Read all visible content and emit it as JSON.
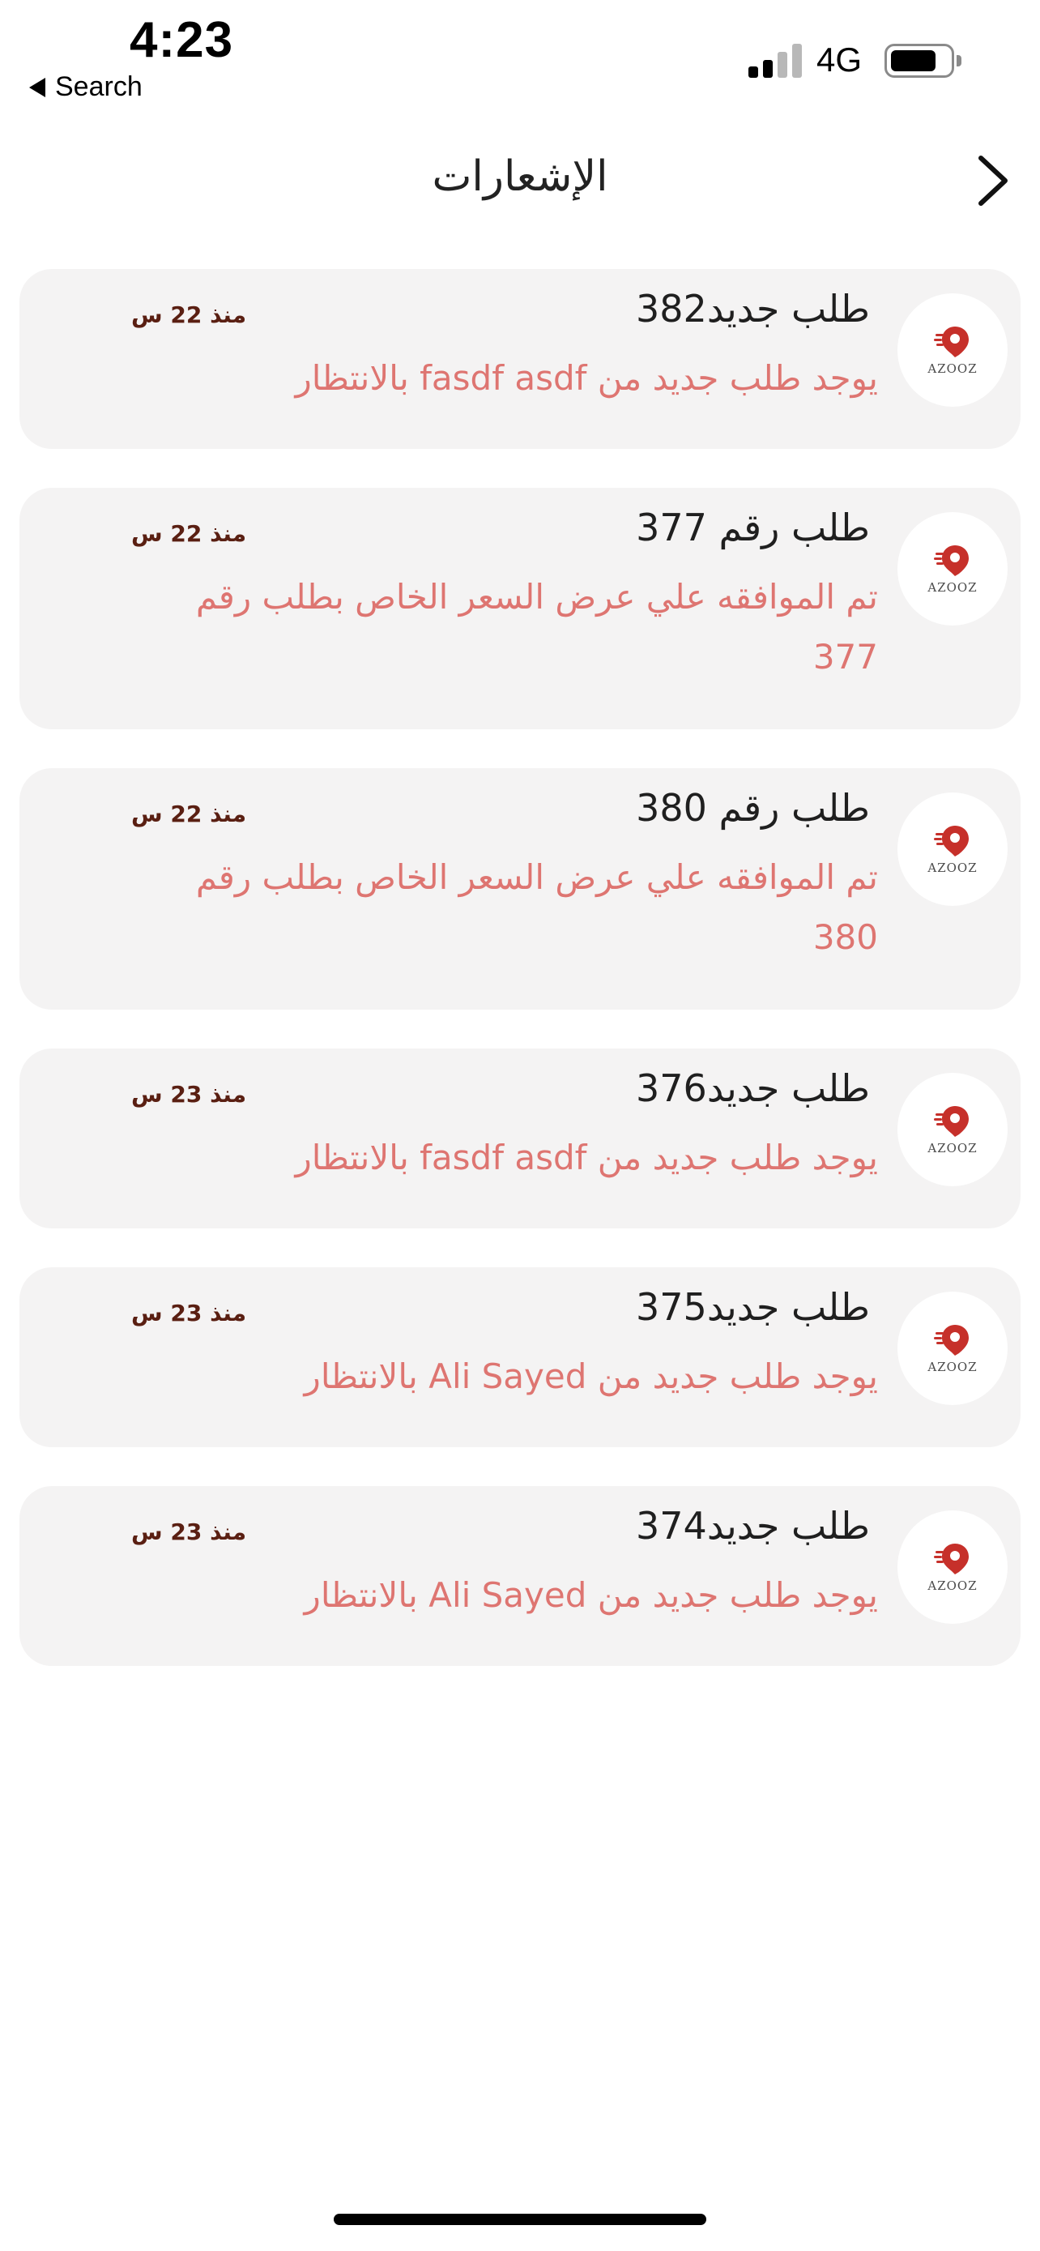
{
  "status_bar": {
    "time": "4:23",
    "back_app_label": "Search",
    "network": "4G"
  },
  "header": {
    "title": "الإشعارات"
  },
  "brand": {
    "logo_text": "AZOOZ",
    "accent_color": "#c6302a"
  },
  "notifications": [
    {
      "title": "طلب جديد382",
      "time": "منذ 22 س",
      "body": "يوجد طلب جديد من  fasdf asdf  بالانتظار"
    },
    {
      "title": "طلب رقم 377",
      "time": "منذ 22 س",
      "body": "تم الموافقه علي عرض السعر الخاص بطلب رقم 377"
    },
    {
      "title": "طلب رقم 380",
      "time": "منذ 22 س",
      "body": "تم الموافقه علي عرض السعر الخاص بطلب رقم 380"
    },
    {
      "title": "طلب جديد376",
      "time": "منذ 23 س",
      "body": "يوجد طلب جديد من  fasdf asdf  بالانتظار"
    },
    {
      "title": "طلب جديد375",
      "time": "منذ 23 س",
      "body": "يوجد طلب جديد من  Ali Sayed  بالانتظار"
    },
    {
      "title": "طلب جديد374",
      "time": "منذ 23 س",
      "body": "يوجد طلب جديد من  Ali Sayed  بالانتظار"
    }
  ]
}
